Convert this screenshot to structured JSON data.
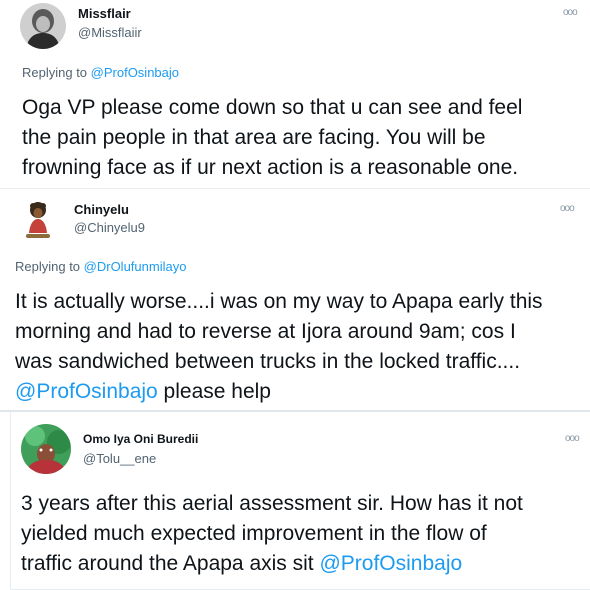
{
  "tweets": [
    {
      "name": "Missflair",
      "handle": "@Missflaiir",
      "more_icon": "ooo",
      "replying_prefix": "Replying to ",
      "replying_to": "@ProfOsinbajo",
      "body_lines": [
        "Oga VP please come down so that u can see and feel",
        "the pain people in that area are facing. You will be",
        "frowning face as if ur next action is a reasonable one."
      ]
    },
    {
      "name": "Chinyelu",
      "handle": "@Chinyelu9",
      "more_icon": "ooo",
      "replying_prefix": "Replying to ",
      "replying_to": "@DrOlufunmilayo",
      "body_lines": [
        "It is actually worse....i was on my way to Apapa early this",
        "morning and had to reverse at Ijora around 9am; cos I",
        "was sandwiched between trucks in the locked traffic...."
      ],
      "body_mention": "@ProfOsinbajo",
      "body_tail": " please help"
    },
    {
      "name": "Omo Iya Oni Buredii",
      "handle": "@Tolu__ene",
      "more_icon": "ooo",
      "body_lines": [
        "3 years after this aerial assessment sir. How has it not",
        "yielded much expected improvement in the flow of"
      ],
      "body_last": "traffic around the Apapa axis sit ",
      "body_mention": "@ProfOsinbajo"
    }
  ]
}
